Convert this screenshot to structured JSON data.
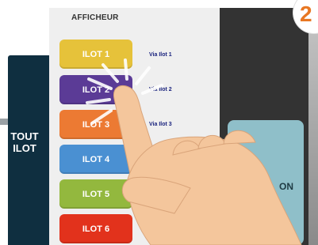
{
  "left_panel": {
    "label": "TOUT\nILOT"
  },
  "afficheur": {
    "title": "AFFICHEUR"
  },
  "ilots": [
    {
      "label": "ILOT 1",
      "color": "#e6c23a",
      "via": "Via Ilot 1"
    },
    {
      "label": "ILOT 2",
      "color": "#5b3b96",
      "via": "Via Ilot 2"
    },
    {
      "label": "ILOT 3",
      "color": "#ec7a33",
      "via": "Via Ilot 3"
    },
    {
      "label": "ILOT 4",
      "color": "#4a90d2",
      "via": ""
    },
    {
      "label": "ILOT 5",
      "color": "#93b83e",
      "via": ""
    },
    {
      "label": "ILOT 6",
      "color": "#e2321c",
      "via": ""
    }
  ],
  "right_card": {
    "text": "ON"
  },
  "step": {
    "number": "2"
  },
  "colors": {
    "skin": "#f4c69c",
    "accent": "#e87722",
    "dark_panel": "#0f2f40"
  }
}
